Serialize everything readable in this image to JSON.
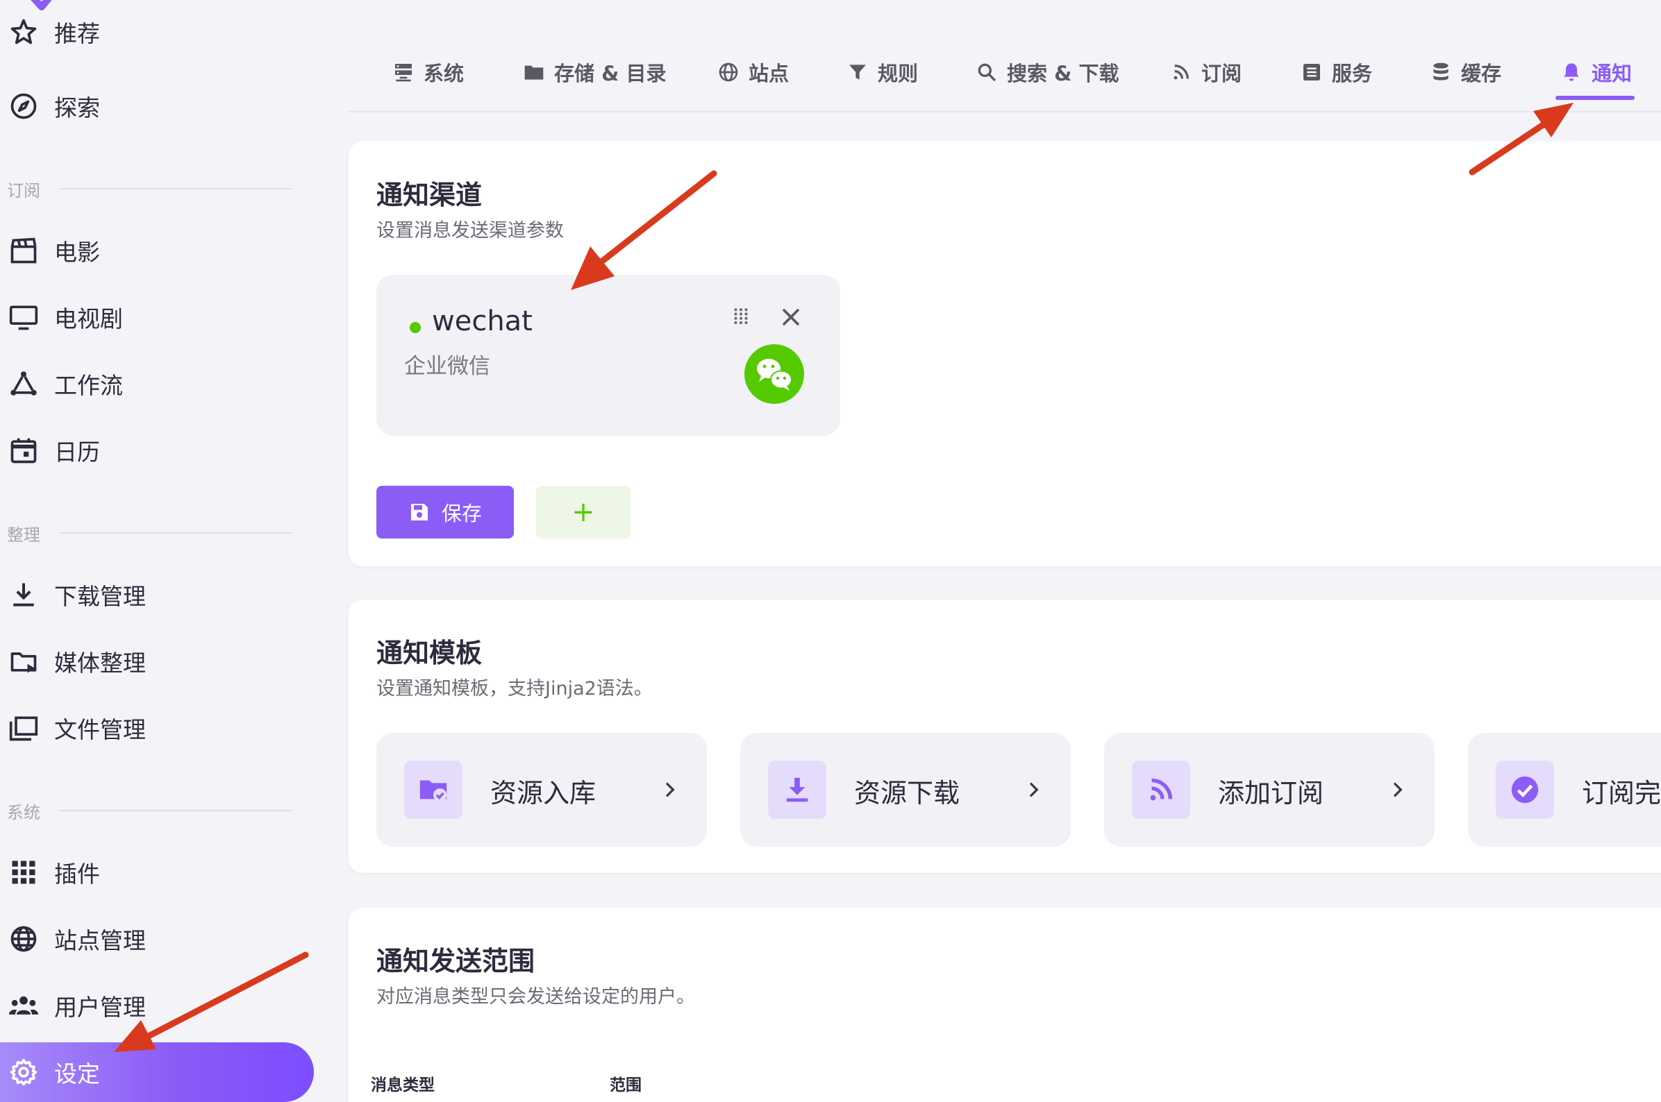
{
  "sidebar": {
    "items": {
      "recommend": "推荐",
      "explore": "探索",
      "movies": "电影",
      "tv": "电视剧",
      "workflow": "工作流",
      "calendar": "日历",
      "downloads": "下载管理",
      "media": "媒体整理",
      "files": "文件管理",
      "plugins": "插件",
      "sites": "站点管理",
      "users": "用户管理",
      "settings": "设定"
    },
    "sections": {
      "subscribe": "订阅",
      "organize": "整理",
      "system": "系统"
    }
  },
  "tabs": {
    "system": "系统",
    "storage": "存储 & 目录",
    "sites": "站点",
    "rules": "规则",
    "search": "搜索 & 下载",
    "subscribe": "订阅",
    "services": "服务",
    "cache": "缓存",
    "notify": "通知"
  },
  "channels_card": {
    "title": "通知渠道",
    "subtitle": "设置消息发送渠道参数",
    "channel": {
      "name": "wechat",
      "type": "企业微信",
      "status_color": "#56ca00"
    },
    "save_label": "保存",
    "add_label": "+"
  },
  "templates_card": {
    "title": "通知模板",
    "subtitle": "设置通知模板，支持Jinja2语法。",
    "templates": [
      "资源入库",
      "资源下载",
      "添加订阅",
      "订阅完成"
    ]
  },
  "scope_card": {
    "title": "通知发送范围",
    "subtitle": "对应消息类型只会发送给设定的用户。",
    "col_type": "消息类型",
    "col_scope": "范围"
  },
  "colors": {
    "accent": "#8b5cf6",
    "success": "#56ca00",
    "annotation_arrow": "#d93a1e"
  }
}
